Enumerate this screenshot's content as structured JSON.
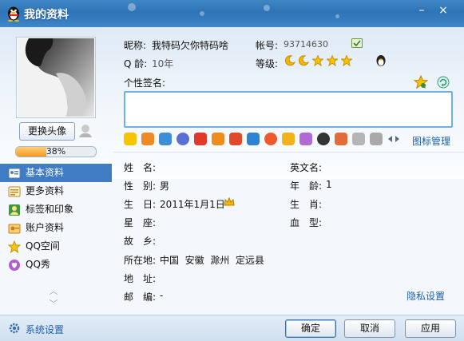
{
  "window": {
    "title": "我的资料",
    "min_glyph": "–",
    "close_glyph": "×"
  },
  "left": {
    "change_avatar_label": "更换头像",
    "completeness_percent": 38,
    "completeness_text": "38%"
  },
  "sidebar": {
    "items": [
      {
        "label": "基本资料",
        "icon": "id-card-icon",
        "active": true
      },
      {
        "label": "更多资料",
        "icon": "card-list-icon",
        "active": false
      },
      {
        "label": "标签和印象",
        "icon": "tag-person-icon",
        "active": false
      },
      {
        "label": "账户资料",
        "icon": "account-icon",
        "active": false
      },
      {
        "label": "QQ空间",
        "icon": "star-icon",
        "active": false
      },
      {
        "label": "QQ秀",
        "icon": "heart-bubble-icon",
        "active": false
      }
    ]
  },
  "header": {
    "nickname_label": "昵称:",
    "nickname_value": "我特码欠你特码啥",
    "account_label": "帐号:",
    "account_value": "93714630",
    "qage_label": "Q 龄:",
    "qage_value": "10年",
    "level_label": "等级:",
    "signature_label": "个性签名:"
  },
  "icon_manage_label": "图标管理",
  "profile": {
    "name_label": "姓　名:",
    "name_value": "",
    "english_name_label": "英文名:",
    "english_name_value": "",
    "gender_label": "性　别:",
    "gender_value": "男",
    "age_label": "年　龄:",
    "age_value": "1",
    "birthday_label": "生　日:",
    "birthday_value": "2011年1月1日",
    "zodiac_label": "生　肖:",
    "zodiac_value": "",
    "constellation_label": "星　座:",
    "constellation_value": "",
    "blood_label": "血　型:",
    "blood_value": "",
    "hometown_label": "故　乡:",
    "hometown_value": "",
    "location_label": "所在地:",
    "location_value": "中国  安徽  滁州  定远县",
    "address_label": "地　址:",
    "address_value": "",
    "zip_label": "邮　编:",
    "zip_value": "-"
  },
  "privacy_label": "隐私设置",
  "footer": {
    "system_settings_label": "系统设置",
    "ok_label": "确定",
    "cancel_label": "取消",
    "apply_label": "应用"
  },
  "colors": {
    "titlebar": "#2e74b6",
    "accent": "#3f7cc3",
    "link": "#1f5fa8",
    "progress": "#f29a1f"
  }
}
